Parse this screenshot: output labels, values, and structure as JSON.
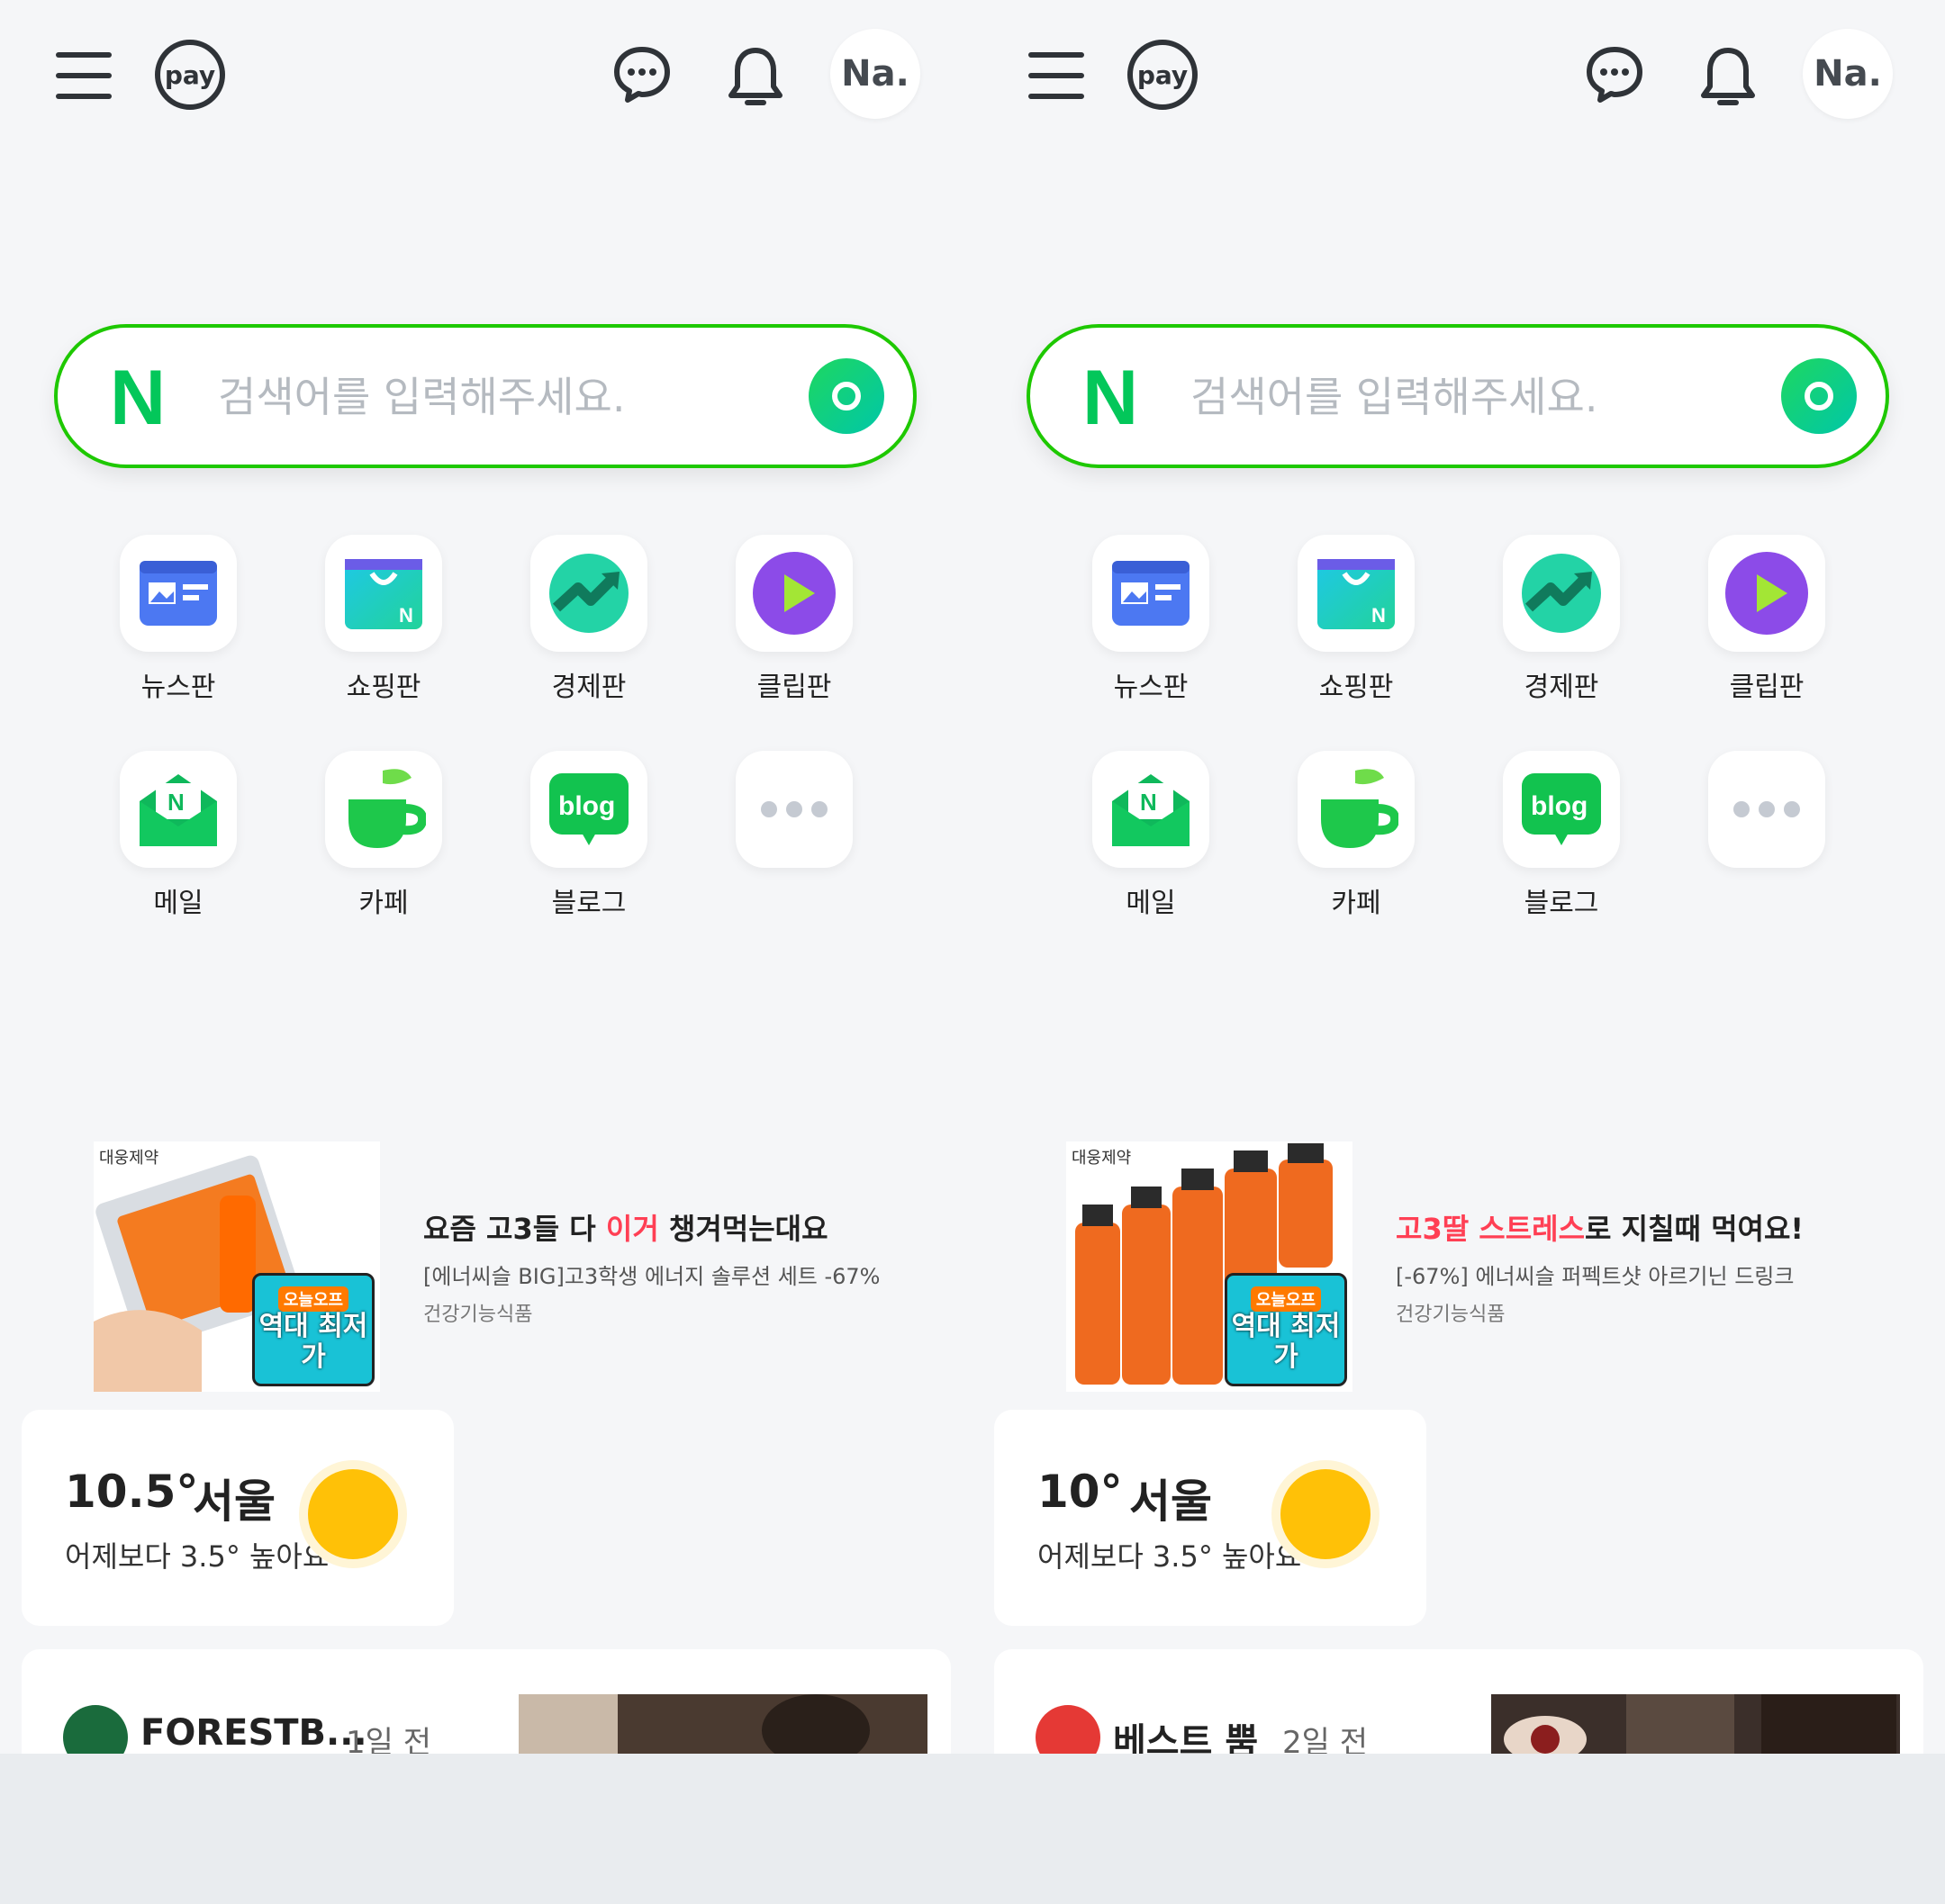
{
  "panels": [
    {
      "header": {
        "menu_icon": "hamburger-menu-icon",
        "pay_label": "pay",
        "chat_icon": "chat-bubble-icon",
        "bell_icon": "bell-icon",
        "avatar_label": "Na."
      },
      "search": {
        "logo": "N",
        "placeholder": "검색어를 입력해주세요."
      },
      "services": [
        {
          "label": "뉴스판",
          "icon": "newspaper-icon"
        },
        {
          "label": "쇼핑판",
          "icon": "shopping-bag-icon"
        },
        {
          "label": "경제판",
          "icon": "trending-up-icon"
        },
        {
          "label": "클립판",
          "icon": "play-icon"
        },
        {
          "label": "메일",
          "icon": "mail-icon"
        },
        {
          "label": "카페",
          "icon": "cafe-cup-icon"
        },
        {
          "label": "블로그",
          "icon": "blog-icon",
          "icon_text": "blog"
        },
        {
          "label": "",
          "icon": "more-dots-icon"
        }
      ],
      "ad": {
        "brand": "대웅제약",
        "title_pre": "요즘 고3들 다 ",
        "title_hl": "이거",
        "title_post": " 챙겨먹는대요",
        "subtitle": "[에너씨슬 BIG]고3학생 에너지 솔루션 세트 -67%",
        "category": "건강기능식품",
        "sticker_top": "오늘오프",
        "sticker_main": "역대 최저가"
      },
      "weather": {
        "temp": "10.5°",
        "city": "서울",
        "desc": "어제보다 3.5° 높아요"
      },
      "feed": {
        "author": "FORESTB...",
        "time": "1일 전",
        "avatar_color": "#1a6b3c"
      }
    },
    {
      "header": {
        "menu_icon": "hamburger-menu-icon",
        "pay_label": "pay",
        "chat_icon": "chat-bubble-icon",
        "bell_icon": "bell-icon",
        "avatar_label": "Na."
      },
      "search": {
        "logo": "N",
        "placeholder": "검색어를 입력해주세요."
      },
      "services": [
        {
          "label": "뉴스판",
          "icon": "newspaper-icon"
        },
        {
          "label": "쇼핑판",
          "icon": "shopping-bag-icon"
        },
        {
          "label": "경제판",
          "icon": "trending-up-icon"
        },
        {
          "label": "클립판",
          "icon": "play-icon"
        },
        {
          "label": "메일",
          "icon": "mail-icon"
        },
        {
          "label": "카페",
          "icon": "cafe-cup-icon"
        },
        {
          "label": "블로그",
          "icon": "blog-icon",
          "icon_text": "blog"
        },
        {
          "label": "",
          "icon": "more-dots-icon"
        }
      ],
      "ad": {
        "brand": "대웅제약",
        "title_pre": "",
        "title_hl": "고3딸 스트레스",
        "title_post": "로 지칠때 먹여요!",
        "subtitle": "[-67%] 에너씨슬 퍼펙트샷 아르기닌 드링크",
        "category": "건강기능식품",
        "sticker_top": "오늘오프",
        "sticker_main": "역대 최저가"
      },
      "weather": {
        "temp": "10°",
        "city": "서울",
        "desc": "어제보다 3.5° 높아요"
      },
      "feed": {
        "author": "베스트 뿜",
        "time": "2일 전",
        "avatar_color": "#e53935"
      }
    }
  ],
  "colors": {
    "naver_green": "#03c75a",
    "search_border": "#1ec800",
    "highlight_red": "#ff3f54",
    "sun": "#ffc107",
    "background": "#f5f6f8"
  }
}
